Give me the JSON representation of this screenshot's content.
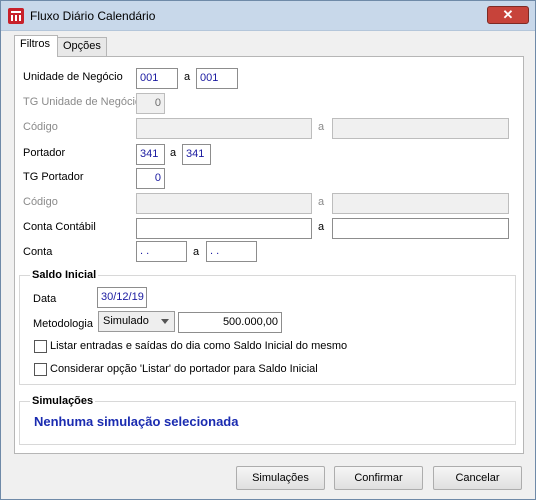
{
  "window": {
    "title": "Fluxo Diário Calendário",
    "close_label": "✕"
  },
  "tabs": [
    {
      "label": "Filtros"
    },
    {
      "label": "Opções"
    }
  ],
  "filters": {
    "unidade_negocio": {
      "label": "Unidade de Negócio",
      "from": "001",
      "sep": "a",
      "to": "001"
    },
    "tg_unidade_negocio": {
      "label": "TG Unidade de Negócio",
      "value": "0"
    },
    "codigo1": {
      "label": "Código",
      "from": "",
      "sep": "a",
      "to": ""
    },
    "portador": {
      "label": "Portador",
      "from": "341",
      "sep": "a",
      "to": "341"
    },
    "tg_portador": {
      "label": "TG Portador",
      "value": "0"
    },
    "codigo2": {
      "label": "Código",
      "from": "",
      "sep": "a",
      "to": ""
    },
    "conta_contabil": {
      "label": "Conta Contábil",
      "from": "",
      "sep": "a",
      "to": ""
    },
    "conta": {
      "label": "Conta",
      "from": ". .",
      "sep": "a",
      "to": ". ."
    }
  },
  "saldo_inicial": {
    "title": "Saldo Inicial",
    "data_label": "Data",
    "data_value": "30/12/19",
    "metodologia_label": "Metodologia",
    "metodologia_value": "Simulado",
    "valor": "500.000,00",
    "chk1_label": "Listar entradas e saídas do dia como Saldo Inicial do mesmo",
    "chk2_label": "Considerar opção 'Listar' do portador para Saldo Inicial"
  },
  "simulacoes": {
    "title": "Simulações",
    "text": "Nenhuma simulação selecionada"
  },
  "buttons": {
    "simulacoes": "Simulações",
    "confirmar": "Confirmar",
    "cancelar": "Cancelar"
  }
}
